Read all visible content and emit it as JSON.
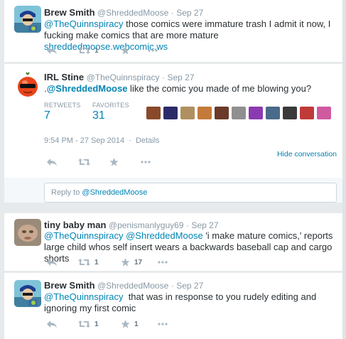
{
  "tweets": [
    {
      "name": "Brew Smith",
      "handle": "@ShreddedMoose",
      "sep": "·",
      "time": "Sep 27",
      "mention": "@TheQuinnspiracy",
      "text": " those comics were immature trash I admit it now, I fucking make comics that are more mature ",
      "link": "shreddedmoose.webcomic.ws",
      "retweets": "1",
      "favorites": ""
    },
    {
      "name": "IRL Stine",
      "handle": "@TheQuinnspiracy",
      "sep": "·",
      "time": "Sep 27",
      "prefix": ".",
      "mention": "@ShreddedMoose",
      "text": " like the comic you made of me blowing you?",
      "retweets_label": "RETWEETS",
      "retweets": "7",
      "favorites_label": "FAVORITES",
      "favorites": "31",
      "timestamp": "9:54 PM - 27 Sep 2014",
      "meta_sep": "·",
      "details": "Details",
      "hide_conversation": "Hide conversation"
    },
    {
      "name": "tiny baby man",
      "handle": "@penismanlyguy69",
      "sep": "·",
      "time": "Sep 27",
      "mention": "@TheQuinnspiracy",
      "mention2": "@ShreddedMoose",
      "text": " 'i make mature comics,' reports large child whos self insert wears a backwards baseball cap and cargo shorts",
      "retweets": "1",
      "favorites": "17"
    },
    {
      "name": "Brew Smith",
      "handle": "@ShreddedMoose",
      "sep": "·",
      "time": "Sep 27",
      "mention": "@TheQuinnspiracy",
      "text": "  that was in response to you rudely editing and ignoring my first comic",
      "retweets": "1",
      "favorites": "1"
    }
  ],
  "reply": {
    "prefix": "Reply to ",
    "target": "@ShreddedMoose"
  },
  "icons": [
    "reply-icon",
    "retweet-icon",
    "favorite-icon",
    "more-icon"
  ],
  "colors": {
    "link": "#0084b4",
    "muted": "#8899a6",
    "icon": "#aab8c2",
    "text": "#292f33",
    "background": "#e7eaec"
  }
}
